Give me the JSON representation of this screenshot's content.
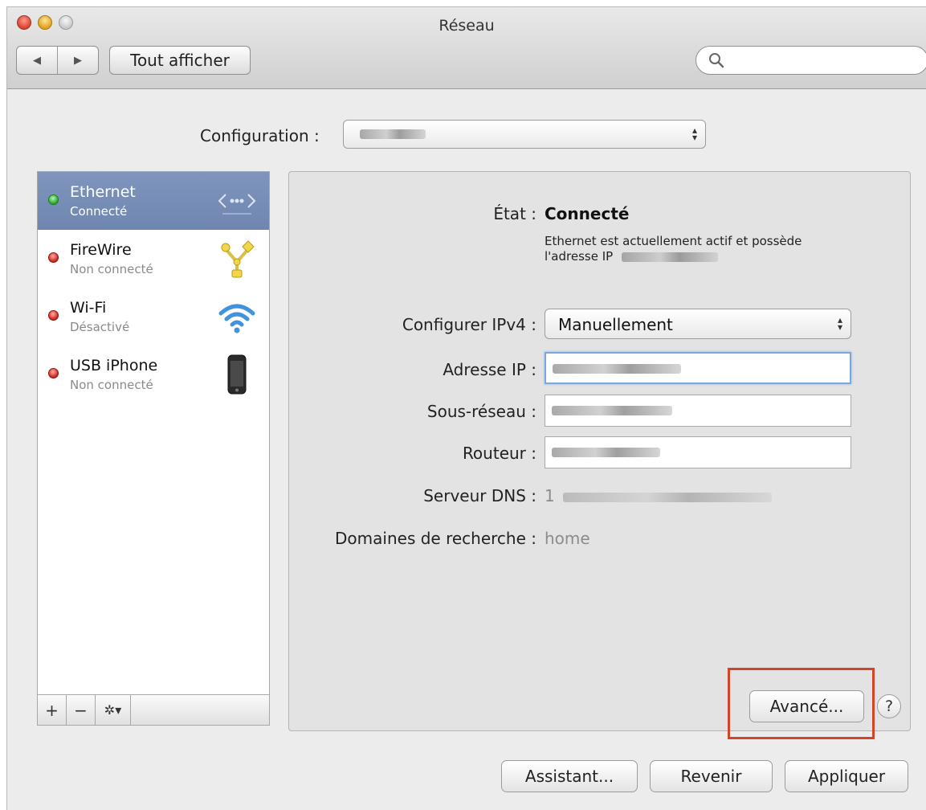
{
  "window": {
    "title": "Réseau",
    "back_glyph": "◀",
    "forward_glyph": "▶",
    "show_all_label": "Tout afficher",
    "search_placeholder": ""
  },
  "configuration": {
    "label": "Configuration :",
    "value_redacted": true
  },
  "sidebar": {
    "services": [
      {
        "name": "Ethernet",
        "status": "Connecté",
        "status_color": "#25a62b",
        "icon": "ethernet-icon",
        "selected": true
      },
      {
        "name": "FireWire",
        "status": "Non connecté",
        "status_color": "#cc2019",
        "icon": "firewire-icon",
        "selected": false
      },
      {
        "name": "Wi-Fi",
        "status": "Désactivé",
        "status_color": "#cc2019",
        "icon": "wifi-icon",
        "selected": false
      },
      {
        "name": "USB iPhone",
        "status": "Non connecté",
        "status_color": "#cc2019",
        "icon": "iphone-icon",
        "selected": false
      }
    ],
    "footer": {
      "add": "+",
      "remove": "−",
      "gear": "✲▾"
    }
  },
  "detail": {
    "state_label": "État :",
    "state_value": "Connecté",
    "state_desc_line1": "Ethernet est actuellement actif et possède",
    "state_desc_line2": "l'adresse IP",
    "configure_ipv4_label": "Configurer IPv4 :",
    "configure_ipv4_value": "Manuellement",
    "ip_label": "Adresse IP :",
    "subnet_label": "Sous-réseau :",
    "router_label": "Routeur :",
    "dns_label": "Serveur DNS :",
    "dns_prefix": "1",
    "search_domains_label": "Domaines de recherche :",
    "search_domains_value": "home",
    "advanced_button": "Avancé...",
    "help_button": "?"
  },
  "footer": {
    "assistant_button": "Assistant...",
    "revert_button": "Revenir",
    "apply_button": "Appliquer"
  },
  "colors": {
    "selection": "#7388b2",
    "connected": "#25a62b",
    "disconnected": "#cc2019",
    "highlight_box": "#d2452c",
    "focus_ring": "#7aa7e0"
  }
}
